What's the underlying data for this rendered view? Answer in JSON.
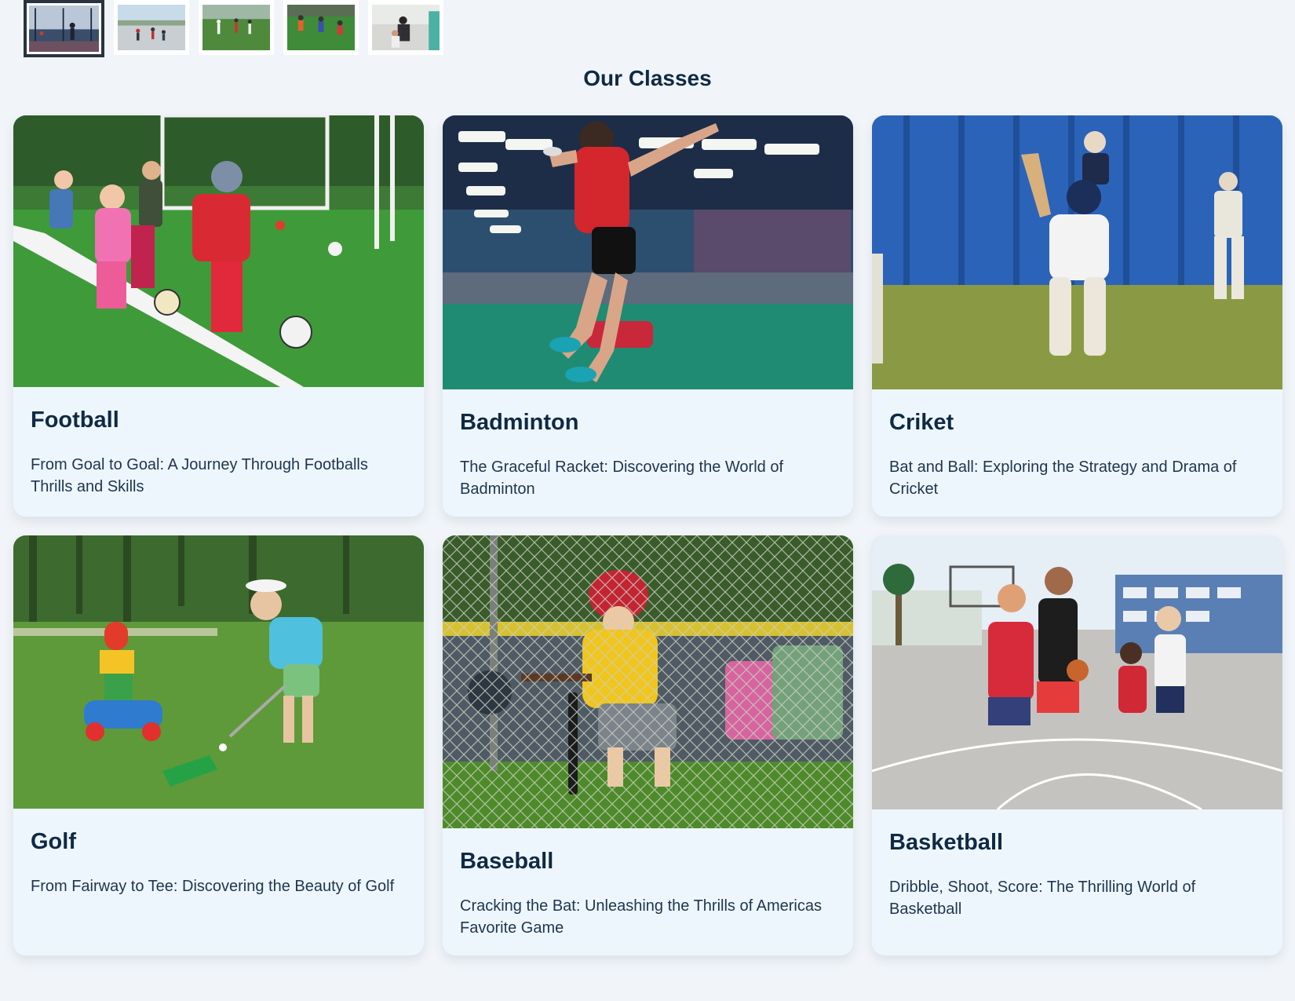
{
  "thumbnails": [
    {
      "label": "thumbnail-1",
      "active": true
    },
    {
      "label": "thumbnail-2",
      "active": false
    },
    {
      "label": "thumbnail-3",
      "active": false
    },
    {
      "label": "thumbnail-4",
      "active": false
    },
    {
      "label": "thumbnail-5",
      "active": false
    }
  ],
  "section": {
    "title": "Our Classes"
  },
  "classes": [
    {
      "title": "Football",
      "description": "From Goal to Goal: A Journey Through Footballs Thrills and Skills"
    },
    {
      "title": "Badminton",
      "description": "The Graceful Racket: Discovering the World of Badminton"
    },
    {
      "title": "Criket",
      "description": "Bat and Ball: Exploring the Strategy and Drama of Cricket"
    },
    {
      "title": "Golf",
      "description": "From Fairway to Tee: Discovering the Beauty of Golf"
    },
    {
      "title": "Baseball",
      "description": "Cracking the Bat: Unleashing the Thrills of Americas Favorite Game"
    },
    {
      "title": "Basketball",
      "description": "Dribble, Shoot, Score: The Thrilling World of Basketball"
    }
  ],
  "colors": {
    "page_background": "#f1f5f9",
    "card_background": "#eef6fd",
    "heading": "#0f2a44",
    "body_text": "#1d3550"
  }
}
